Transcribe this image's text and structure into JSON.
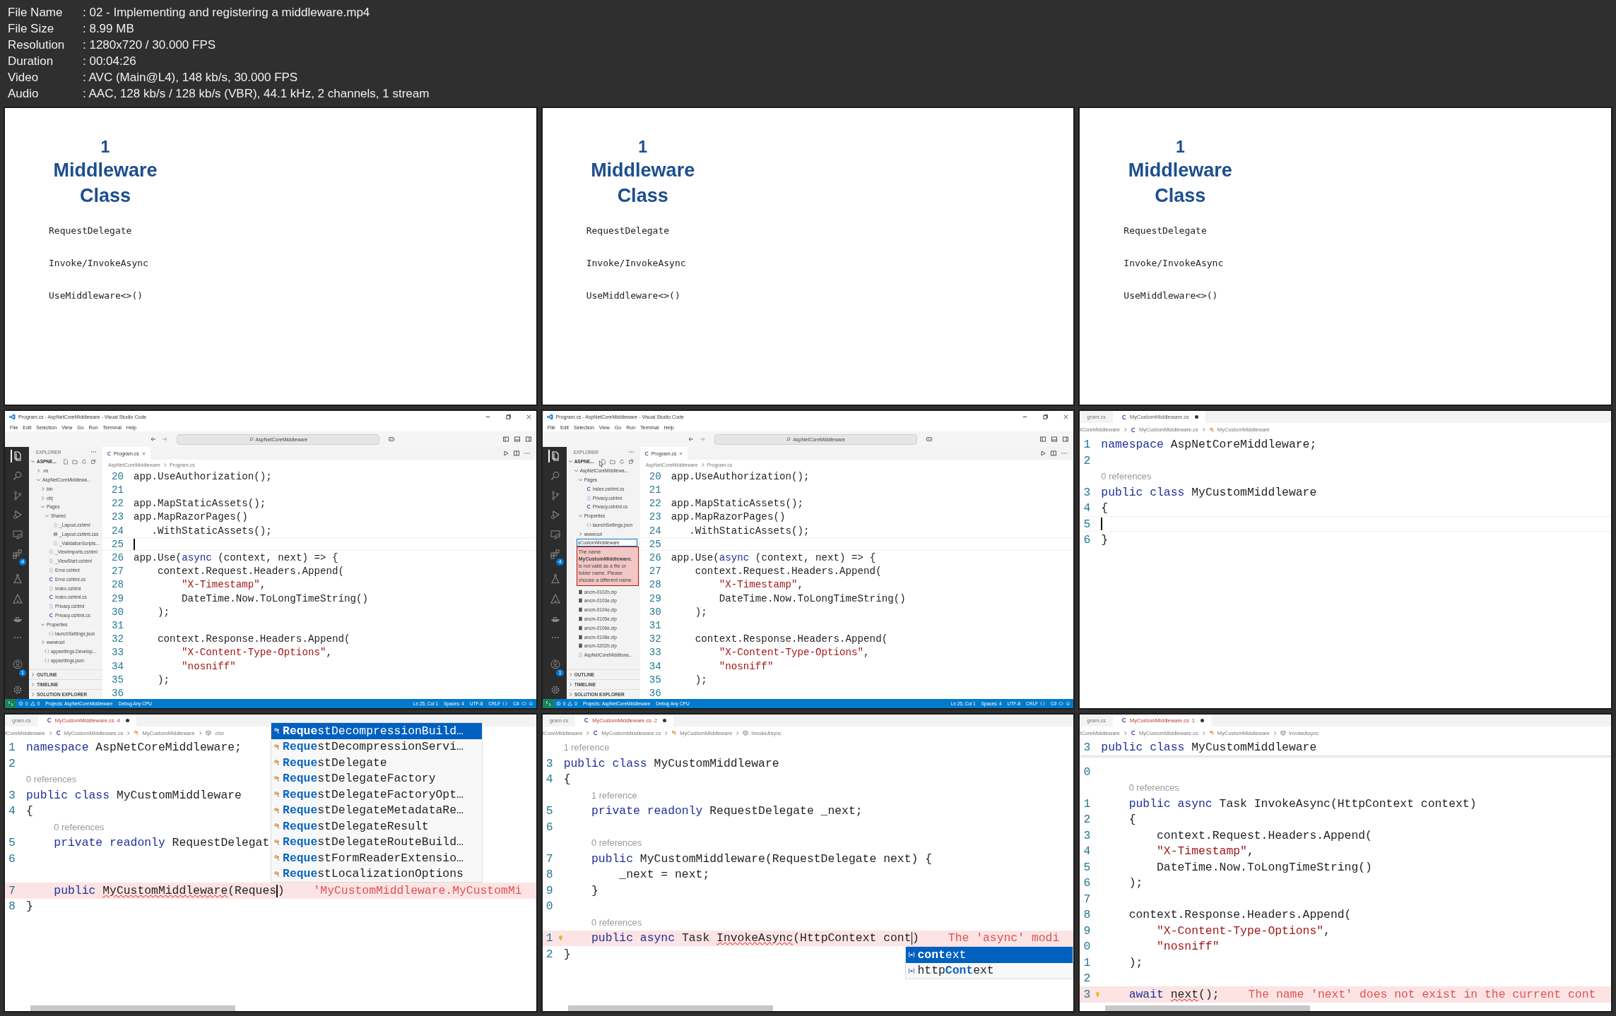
{
  "media_info": [
    {
      "label": "File Name",
      "value": ": 02 - Implementing and registering a middleware.mp4"
    },
    {
      "label": "File Size",
      "value": ": 8.99 MB"
    },
    {
      "label": "Resolution",
      "value": ": 1280x720 / 30.000 FPS"
    },
    {
      "label": "Duration",
      "value": ": 00:04:26"
    },
    {
      "label": "Video",
      "value": ": AVC (Main@L4), 148 kb/s, 30.000 FPS"
    },
    {
      "label": "Audio",
      "value": ": AAC, 128 kb/s / 128 kb/s (VBR), 44.1 kHz, 2 channels, 1 stream"
    }
  ],
  "frames": [
    {
      "kind": "slide",
      "number": "1",
      "title": "Middleware Class",
      "bullets": [
        "RequestDelegate",
        "Invoke/InvokeAsync",
        "UseMiddleware<>()"
      ]
    },
    {
      "kind": "slide",
      "number": "1",
      "title": "Middleware Class",
      "bullets": [
        "RequestDelegate",
        "Invoke/InvokeAsync",
        "UseMiddleware<>()"
      ]
    },
    {
      "kind": "slide",
      "number": "1",
      "title": "Middleware Class",
      "bullets": [
        "RequestDelegate",
        "Invoke/InvokeAsync",
        "UseMiddleware<>()"
      ]
    },
    {
      "kind": "vscode",
      "window_title": "Program.cs - AspNetCoreMiddleware - Visual Studio Code",
      "menu": [
        "File",
        "Edit",
        "Selection",
        "View",
        "Go",
        "Run",
        "Terminal",
        "Help"
      ],
      "search": "AspNetCoreMiddleware",
      "activity": [
        {
          "kind": "files",
          "selected": true
        },
        {
          "kind": "search",
          "selected": false
        },
        {
          "kind": "branch",
          "selected": false
        },
        {
          "kind": "debug",
          "selected": false
        },
        {
          "kind": "monitor",
          "selected": false
        },
        {
          "kind": "blocks",
          "selected": false,
          "badge": "4"
        },
        {
          "kind": "flask",
          "selected": false
        },
        {
          "kind": "triangle",
          "selected": false
        },
        {
          "kind": "whale",
          "selected": false
        },
        {
          "kind": "more",
          "selected": false
        },
        {
          "kind": "account",
          "selected": false,
          "badge": "1"
        },
        {
          "kind": "gear",
          "selected": false
        }
      ],
      "explorer": {
        "title": "EXPLORER",
        "root": "ASPNE...",
        "tree": [
          {
            "kind": "folder",
            "label": ".vs",
            "expanded": false
          },
          {
            "kind": "folder",
            "label": "AspNetCoreMiddlewa...",
            "expanded": true,
            "children": [
              {
                "kind": "folder",
                "label": "bin",
                "expanded": false
              },
              {
                "kind": "folder",
                "label": "obj",
                "expanded": false
              },
              {
                "kind": "folder",
                "label": "Pages",
                "expanded": true,
                "children": [
                  {
                    "kind": "folder",
                    "label": "Shared",
                    "expanded": true,
                    "children": [
                      {
                        "kind": "page",
                        "label": "_Layout.cshtml"
                      },
                      {
                        "kind": "stylesheet",
                        "label": "_Layout.cshtml.css"
                      },
                      {
                        "kind": "page",
                        "label": "_ValidationScripts..."
                      }
                    ]
                  },
                  {
                    "kind": "page",
                    "label": "_ViewImports.cshtml"
                  },
                  {
                    "kind": "page",
                    "label": "_ViewStart.cshtml"
                  },
                  {
                    "kind": "page",
                    "label": "Error.cshtml"
                  },
                  {
                    "kind": "csharp",
                    "label": "Error.cshtml.cs"
                  },
                  {
                    "kind": "page",
                    "label": "Index.cshtml"
                  },
                  {
                    "kind": "csharp",
                    "label": "Index.cshtml.cs"
                  },
                  {
                    "kind": "page",
                    "label": "Privacy.cshtml"
                  },
                  {
                    "kind": "csharp",
                    "label": "Privacy.cshtml.cs"
                  }
                ]
              },
              {
                "kind": "folder",
                "label": "Properties",
                "expanded": true,
                "children": [
                  {
                    "kind": "json",
                    "label": "launchSettings.json"
                  }
                ]
              },
              {
                "kind": "folder",
                "label": "wwwroot",
                "expanded": false
              },
              {
                "kind": "json",
                "label": "appsettings.Develop..."
              },
              {
                "kind": "json",
                "label": "appsettings.json"
              }
            ]
          }
        ],
        "sections": [
          "OUTLINE",
          "TIMELINE",
          "SOLUTION EXPLORER"
        ]
      },
      "tab": "Program.cs",
      "breadcrumbs": [
        "AspNetCoreMiddleware",
        "Program.cs"
      ],
      "lines": [
        {
          "number": "20",
          "text": "app.UseAuthorization();"
        },
        {
          "number": "21"
        },
        {
          "number": "22",
          "text": "app.MapStaticAssets();"
        },
        {
          "number": "23",
          "text": "app.MapRazorPages()"
        },
        {
          "number": "24",
          "text": "   .WithStaticAssets();"
        },
        {
          "number": "25",
          "current": true,
          "tokens": [
            {
              "kind": "caret"
            }
          ]
        },
        {
          "number": "26",
          "tokens": [
            {
              "kind": "plain",
              "text": "app.Use("
            },
            {
              "kind": "keyword",
              "text": "async"
            },
            {
              "kind": "plain",
              "text": " (context, next) => {"
            }
          ]
        },
        {
          "number": "27",
          "text": "    context.Request.Headers.Append("
        },
        {
          "number": "28",
          "tokens": [
            {
              "kind": "string",
              "text": "        \"X-Timestamp\""
            },
            {
              "kind": "plain",
              "text": ","
            }
          ]
        },
        {
          "number": "29",
          "text": "        DateTime.Now.ToLongTimeString()"
        },
        {
          "number": "30",
          "text": "    );"
        },
        {
          "number": "31"
        },
        {
          "number": "32",
          "text": "    context.Response.Headers.Append("
        },
        {
          "number": "33",
          "tokens": [
            {
              "kind": "string",
              "text": "        \"X-Content-Type-Options\""
            },
            {
              "kind": "plain",
              "text": ","
            }
          ]
        },
        {
          "number": "34",
          "tokens": [
            {
              "kind": "string",
              "text": "        \"nosniff\""
            }
          ]
        },
        {
          "number": "35",
          "text": "    );"
        },
        {
          "number": "36"
        }
      ],
      "status": {
        "errors": "0",
        "warnings": "0",
        "left": [
          "Projects: AspNetCoreMiddleware",
          "Debug Any CPU"
        ],
        "right": [
          "Ln 25, Col 1",
          "Spaces: 4",
          "UTF-8",
          "CRLF",
          "C#"
        ]
      }
    },
    {
      "kind": "vscode",
      "window_title": "Program.cs - AspNetCoreMiddleware - Visual Studio Code",
      "menu": [
        "File",
        "Edit",
        "Selection",
        "View",
        "Go",
        "Run",
        "Terminal",
        "Help"
      ],
      "search": "AspNetCoreMiddleware",
      "activity": [
        {
          "kind": "files",
          "selected": true
        },
        {
          "kind": "search",
          "selected": false
        },
        {
          "kind": "branch",
          "selected": false
        },
        {
          "kind": "debug",
          "selected": false
        },
        {
          "kind": "monitor",
          "selected": false
        },
        {
          "kind": "blocks",
          "selected": false,
          "badge": "4"
        },
        {
          "kind": "flask",
          "selected": false
        },
        {
          "kind": "triangle",
          "selected": false
        },
        {
          "kind": "whale",
          "selected": false
        },
        {
          "kind": "more",
          "selected": false
        },
        {
          "kind": "account",
          "selected": false,
          "badge": "1"
        },
        {
          "kind": "gear",
          "selected": false
        }
      ],
      "explorer": {
        "title": "EXPLORER",
        "root": "ASPNE...",
        "pointer": true,
        "tree": [
          {
            "kind": "folder",
            "label": "AspNetCoreMiddlewa...",
            "expanded": true,
            "children": [
              {
                "kind": "folder",
                "label": "Pages",
                "expanded": true,
                "children": [
                  {
                    "kind": "csharp",
                    "label": "Index.cshtml.cs"
                  },
                  {
                    "kind": "page",
                    "label": "Privacy.cshtml"
                  },
                  {
                    "kind": "csharp",
                    "label": "Privacy.cshtml.cs"
                  }
                ]
              },
              {
                "kind": "folder",
                "label": "Properties",
                "expanded": true,
                "children": [
                  {
                    "kind": "json",
                    "label": "launchSettings.json"
                  }
                ]
              },
              {
                "kind": "folder",
                "label": "wwwroot",
                "expanded": false
              },
              {
                "kind": "rename",
                "value": "yCustomMiddleware",
                "error": "The name **MyCustomMiddleware.** is not valid as a file or folder name. Please choose a different name."
              }
            ]
          },
          {
            "kind": "archive",
            "label": "ancm-0102b.zip"
          },
          {
            "kind": "archive",
            "label": "ancm-0103e.zip"
          },
          {
            "kind": "archive",
            "label": "ancm-0104e.zip"
          },
          {
            "kind": "archive",
            "label": "ancm-0105e.zip"
          },
          {
            "kind": "archive",
            "label": "ancm-0106e.zip"
          },
          {
            "kind": "archive",
            "label": "ancm-0108e.zip"
          },
          {
            "kind": "archive",
            "label": "ancm-0202b.zip"
          },
          {
            "kind": "page",
            "label": "AspNetCoreMiddlewa..."
          }
        ],
        "sections": [
          "OUTLINE",
          "TIMELINE",
          "SOLUTION EXPLORER"
        ]
      },
      "tab": "Program.cs",
      "breadcrumbs": [
        "AspNetCoreMiddleware",
        "Program.cs"
      ],
      "lines": [
        {
          "number": "20",
          "text": "app.UseAuthorization();"
        },
        {
          "number": "21"
        },
        {
          "number": "22",
          "text": "app.MapStaticAssets();"
        },
        {
          "number": "23",
          "text": "app.MapRazorPages()"
        },
        {
          "number": "24",
          "text": "   .WithStaticAssets();"
        },
        {
          "number": "25",
          "current": true
        },
        {
          "number": "26",
          "tokens": [
            {
              "kind": "plain",
              "text": "app.Use("
            },
            {
              "kind": "keyword",
              "text": "async"
            },
            {
              "kind": "plain",
              "text": " (context, next) => {"
            }
          ]
        },
        {
          "number": "27",
          "text": "    context.Request.Headers.Append("
        },
        {
          "number": "28",
          "tokens": [
            {
              "kind": "string",
              "text": "        \"X-Timestamp\""
            },
            {
              "kind": "plain",
              "text": ","
            }
          ]
        },
        {
          "number": "29",
          "text": "        DateTime.Now.ToLongTimeString()"
        },
        {
          "number": "30",
          "text": "    );"
        },
        {
          "number": "31"
        },
        {
          "number": "32",
          "text": "    context.Response.Headers.Append("
        },
        {
          "number": "33",
          "tokens": [
            {
              "kind": "string",
              "text": "        \"X-Content-Type-Options\""
            },
            {
              "kind": "plain",
              "text": ","
            }
          ]
        },
        {
          "number": "34",
          "tokens": [
            {
              "kind": "string",
              "text": "        \"nosniff\""
            }
          ]
        },
        {
          "number": "35",
          "text": "    );"
        },
        {
          "number": "36"
        }
      ],
      "status": {
        "errors": "0",
        "warnings": "0",
        "left": [
          "Projects: AspNetCoreMiddleware",
          "Debug Any CPU"
        ],
        "right": [
          "Ln 25, Col 1",
          "Spaces: 4",
          "UTF-8",
          "CRLF",
          "C#"
        ]
      }
    },
    {
      "kind": "editor",
      "tabs": [
        {
          "label": "gram.cs",
          "selected": false,
          "modified": false
        },
        {
          "label": "MyCustomMiddleware.cs",
          "selected": true,
          "modified": true
        }
      ],
      "breadcrumbs": [
        {
          "label": "tCoreMiddleware"
        },
        {
          "label": "MyCustomMiddleware.cs",
          "kind": "csharp"
        },
        {
          "label": "MyCustomMiddleware",
          "kind": "class"
        }
      ],
      "lines": [
        {
          "number": "1",
          "tokens": [
            {
              "kind": "keyword",
              "text": "namespace"
            },
            {
              "kind": "plain",
              "text": " AspNetCoreMiddleware;"
            }
          ]
        },
        {
          "number": "2"
        },
        {
          "kind": "lens",
          "text": "0 references"
        },
        {
          "number": "3",
          "tokens": [
            {
              "kind": "keyword",
              "text": "public class"
            },
            {
              "kind": "plain",
              "text": " MyCustomMiddleware"
            }
          ]
        },
        {
          "number": "4",
          "text": "{"
        },
        {
          "number": "5",
          "current": true,
          "tokens": [
            {
              "kind": "caret"
            }
          ]
        },
        {
          "number": "6",
          "text": "}"
        }
      ]
    },
    {
      "kind": "editor",
      "horizontal_scroll": true,
      "tabs": [
        {
          "label": "gram.cs",
          "selected": false,
          "modified": false
        },
        {
          "label": "MyCustomMiddleware.cs",
          "selected": true,
          "modified": true,
          "problems": "4"
        }
      ],
      "breadcrumbs": [
        {
          "label": "tCoreMiddleware"
        },
        {
          "label": "MyCustomMiddleware.cs",
          "kind": "csharp"
        },
        {
          "label": "MyCustomMiddleware",
          "kind": "class"
        },
        {
          "label": ".ctor",
          "kind": "method"
        }
      ],
      "lines": [
        {
          "number": "1",
          "tokens": [
            {
              "kind": "keyword",
              "text": "namespace"
            },
            {
              "kind": "plain",
              "text": " AspNetCoreMiddleware;"
            }
          ]
        },
        {
          "number": "2"
        },
        {
          "kind": "lens",
          "text": "0 references"
        },
        {
          "number": "3",
          "tokens": [
            {
              "kind": "keyword",
              "text": "public class"
            },
            {
              "kind": "plain",
              "text": " MyCustomMiddleware"
            }
          ]
        },
        {
          "number": "4",
          "text": "{"
        },
        {
          "kind": "lens",
          "text": "0 references"
        },
        {
          "number": "5",
          "tokens": [
            {
              "kind": "keyword",
              "text": "    private readonly"
            },
            {
              "kind": "plain",
              "text": " RequestDelegat"
            }
          ]
        },
        {
          "number": "6"
        },
        {
          "kind": "covered"
        },
        {
          "number": "7",
          "error": true,
          "tokens": [
            {
              "kind": "keyword",
              "text": "    public "
            },
            {
              "kind": "squiggle",
              "text": "MyCustomMiddleware"
            },
            {
              "kind": "plain",
              "text": "(Reques"
            },
            {
              "kind": "caret"
            },
            {
              "kind": "plain",
              "text": ")"
            }
          ],
          "message": "'MyCustomMiddleware.MyCustomMi"
        },
        {
          "number": "8",
          "text": "}"
        }
      ],
      "suggest": {
        "items": [
          {
            "label": "**Reque**stDecompressionBuild…",
            "kind": "class",
            "selected": true
          },
          {
            "label": "**Reque**stDecompressionServi…",
            "kind": "class",
            "selected": false
          },
          {
            "label": "**Reque**stDelegate",
            "kind": "class",
            "selected": false
          },
          {
            "label": "**Reque**stDelegateFactory",
            "kind": "class",
            "selected": false
          },
          {
            "label": "**Reque**stDelegateFactoryOpt…",
            "kind": "class",
            "selected": false
          },
          {
            "label": "**Reque**stDelegateMetadataRe…",
            "kind": "class",
            "selected": false
          },
          {
            "label": "**Reque**stDelegateResult",
            "kind": "class",
            "selected": false
          },
          {
            "label": "**Reque**stDelegateRouteBuild…",
            "kind": "class",
            "selected": false
          },
          {
            "label": "**Reque**stFormReaderExtensio…",
            "kind": "class",
            "selected": false
          },
          {
            "label": "**Reque**stLocalizationOptions",
            "kind": "class",
            "selected": false
          }
        ]
      }
    },
    {
      "kind": "editor",
      "horizontal_scroll": true,
      "tabs": [
        {
          "label": "gram.cs",
          "selected": false,
          "modified": false
        },
        {
          "label": "MyCustomMiddleware.cs",
          "selected": true,
          "modified": true,
          "problems": "2"
        }
      ],
      "breadcrumbs": [
        {
          "label": "tCoreMiddleware"
        },
        {
          "label": "MyCustomMiddleware.cs",
          "kind": "csharp"
        },
        {
          "label": "MyCustomMiddleware",
          "kind": "class"
        },
        {
          "label": "InvokeAsync",
          "kind": "method"
        }
      ],
      "lines": [
        {
          "kind": "lens",
          "text": "1 reference"
        },
        {
          "number": "3",
          "tokens": [
            {
              "kind": "keyword",
              "text": "public class"
            },
            {
              "kind": "plain",
              "text": " MyCustomMiddleware"
            }
          ]
        },
        {
          "number": "4",
          "text": "{"
        },
        {
          "kind": "lens",
          "text": "1 reference"
        },
        {
          "number": "5",
          "tokens": [
            {
              "kind": "keyword",
              "text": "    private readonly"
            },
            {
              "kind": "plain",
              "text": " RequestDelegate _next;"
            }
          ]
        },
        {
          "number": "6"
        },
        {
          "kind": "lens",
          "text": "0 references"
        },
        {
          "number": "7",
          "tokens": [
            {
              "kind": "keyword",
              "text": "    public"
            },
            {
              "kind": "plain",
              "text": " MyCustomMiddleware(RequestDelegate next) {"
            }
          ]
        },
        {
          "number": "8",
          "text": "        _next = next;"
        },
        {
          "number": "9",
          "text": "    }"
        },
        {
          "number": "0"
        },
        {
          "kind": "lens",
          "text": "0 references"
        },
        {
          "number": "1",
          "error": true,
          "lightbulb": true,
          "tokens": [
            {
              "kind": "keyword",
              "text": "    public async"
            },
            {
              "kind": "plain",
              "text": " Task "
            },
            {
              "kind": "squiggle",
              "text": "InvokeAsync"
            },
            {
              "kind": "plain",
              "text": "(HttpContext cont"
            },
            {
              "kind": "caret"
            },
            {
              "kind": "plain",
              "text": ")"
            }
          ],
          "message": "The 'async' modi"
        },
        {
          "number": "2",
          "text": "}"
        }
      ],
      "suggest": {
        "items": [
          {
            "label": "**cont**ext",
            "kind": "variable",
            "selected": true
          },
          {
            "label": "http**Cont**ext",
            "kind": "variable",
            "selected": false
          }
        ]
      }
    },
    {
      "kind": "editor",
      "horizontal_scroll": true,
      "tabs": [
        {
          "label": "gram.cs",
          "selected": false,
          "modified": false
        },
        {
          "label": "MyCustomMiddleware.cs",
          "selected": true,
          "modified": true,
          "problems": "1"
        }
      ],
      "breadcrumbs": [
        {
          "label": "tCoreMiddleware"
        },
        {
          "label": "MyCustomMiddleware.cs",
          "kind": "csharp"
        },
        {
          "label": "MyCustomMiddleware",
          "kind": "class"
        },
        {
          "label": "InvokeAsync",
          "kind": "method"
        }
      ],
      "sticky": {
        "number": "3",
        "tokens": [
          {
            "kind": "keyword",
            "text": "public class"
          },
          {
            "kind": "plain",
            "text": " MyCustomMiddleware"
          }
        ]
      },
      "lines": [
        {
          "number": "0"
        },
        {
          "kind": "lens",
          "text": "0 references"
        },
        {
          "number": "1",
          "tokens": [
            {
              "kind": "keyword",
              "text": "    public async"
            },
            {
              "kind": "plain",
              "text": " Task InvokeAsync(HttpContext context)"
            }
          ]
        },
        {
          "number": "2",
          "text": "    {"
        },
        {
          "number": "3",
          "text": "        context.Request.Headers.Append("
        },
        {
          "number": "4",
          "tokens": [
            {
              "kind": "string",
              "text": "        \"X-Timestamp\""
            },
            {
              "kind": "plain",
              "text": ","
            }
          ]
        },
        {
          "number": "5",
          "text": "        DateTime.Now.ToLongTimeString()"
        },
        {
          "number": "6",
          "text": "    );"
        },
        {
          "number": "7"
        },
        {
          "number": "8",
          "text": "    context.Response.Headers.Append("
        },
        {
          "number": "9",
          "tokens": [
            {
              "kind": "string",
              "text": "        \"X-Content-Type-Options\""
            },
            {
              "kind": "plain",
              "text": ","
            }
          ]
        },
        {
          "number": "0",
          "tokens": [
            {
              "kind": "string",
              "text": "        \"nosniff\""
            }
          ]
        },
        {
          "number": "1",
          "text": "    );"
        },
        {
          "number": "2"
        },
        {
          "number": "3",
          "error": true,
          "lightbulb": true,
          "tokens": [
            {
              "kind": "keyword",
              "text": "    await "
            },
            {
              "kind": "squiggle",
              "text": "next"
            },
            {
              "kind": "plain",
              "text": "();"
            }
          ],
          "message": "The name 'next' does not exist in the current cont"
        }
      ]
    }
  ]
}
